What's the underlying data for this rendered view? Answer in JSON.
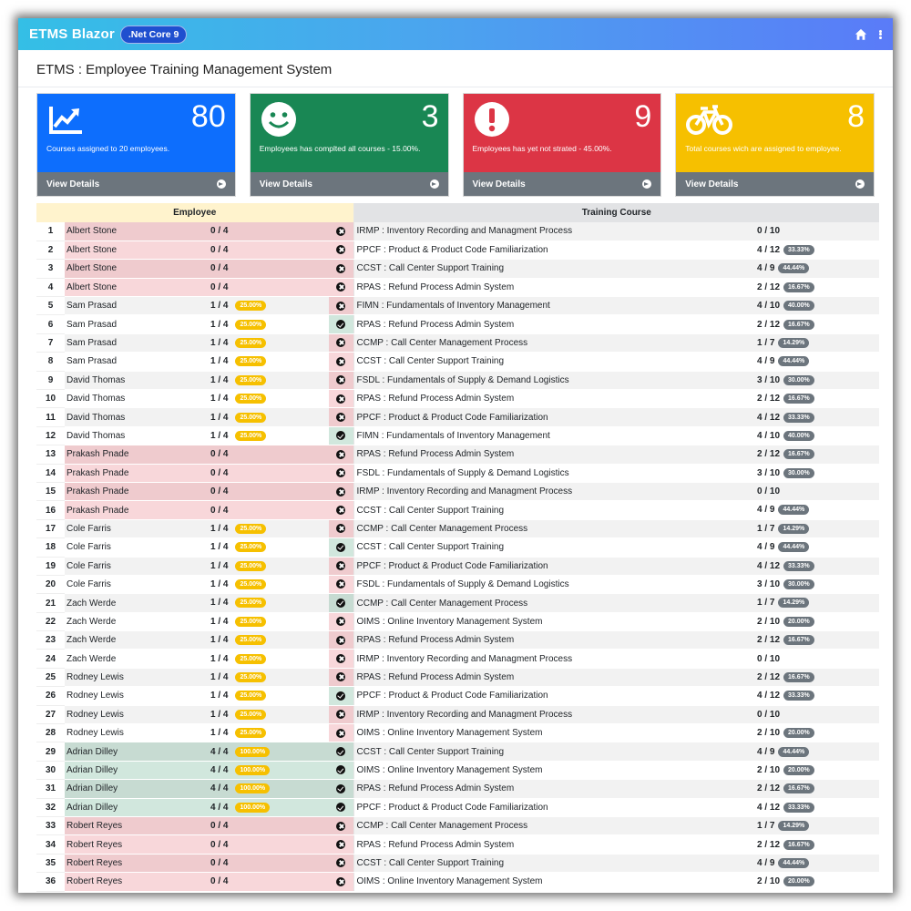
{
  "app": {
    "brand": "ETMS Blazor",
    "version_badge": ".Net Core 9",
    "home_icon": "home-icon",
    "menu_icon": "kebab-menu-icon"
  },
  "page": {
    "title": "ETMS : Employee Training Management System"
  },
  "cards": [
    {
      "icon": "chart-line-icon",
      "number": "80",
      "text": "Courses assigned to 20 employees.",
      "footer": "View Details",
      "color": "#0d6efd"
    },
    {
      "icon": "smile-icon",
      "number": "3",
      "text": "Employees has complted all courses - 15.00%.",
      "footer": "View Details",
      "color": "#198754"
    },
    {
      "icon": "exclamation-circle-icon",
      "number": "9",
      "text": "Employees has yet not strated - 45.00%.",
      "footer": "View Details",
      "color": "#dc3545"
    },
    {
      "icon": "bicycle-icon",
      "number": "8",
      "text": "Total courses wich are assigned to employee.",
      "footer": "View Details",
      "color": "#f6c000"
    }
  ],
  "table": {
    "headers": {
      "employee": "Employee",
      "course": "Training Course"
    },
    "rows": [
      {
        "n": "1",
        "name": "Albert Stone",
        "prog": "0 / 4",
        "pct": "",
        "done": false,
        "course": "IRMP : Inventory Recording and Managment Process",
        "cprog": "0 / 10",
        "cpct": ""
      },
      {
        "n": "2",
        "name": "Albert Stone",
        "prog": "0 / 4",
        "pct": "",
        "done": false,
        "course": "PPCF : Product & Product Code Familiarization",
        "cprog": "4 / 12",
        "cpct": "33.33%"
      },
      {
        "n": "3",
        "name": "Albert Stone",
        "prog": "0 / 4",
        "pct": "",
        "done": false,
        "course": "CCST : Call Center Support Training",
        "cprog": "4 / 9",
        "cpct": "44.44%"
      },
      {
        "n": "4",
        "name": "Albert Stone",
        "prog": "0 / 4",
        "pct": "",
        "done": false,
        "course": "RPAS : Refund Process Admin System",
        "cprog": "2 / 12",
        "cpct": "16.67%"
      },
      {
        "n": "5",
        "name": "Sam Prasad",
        "prog": "1 / 4",
        "pct": "25.00%",
        "done": false,
        "course": "FIMN : Fundamentals of Inventory Management",
        "cprog": "4 / 10",
        "cpct": "40.00%"
      },
      {
        "n": "6",
        "name": "Sam Prasad",
        "prog": "1 / 4",
        "pct": "25.00%",
        "done": true,
        "course": "RPAS : Refund Process Admin System",
        "cprog": "2 / 12",
        "cpct": "16.67%"
      },
      {
        "n": "7",
        "name": "Sam Prasad",
        "prog": "1 / 4",
        "pct": "25.00%",
        "done": false,
        "course": "CCMP : Call Center Management Process",
        "cprog": "1 / 7",
        "cpct": "14.29%"
      },
      {
        "n": "8",
        "name": "Sam Prasad",
        "prog": "1 / 4",
        "pct": "25.00%",
        "done": false,
        "course": "CCST : Call Center Support Training",
        "cprog": "4 / 9",
        "cpct": "44.44%"
      },
      {
        "n": "9",
        "name": "David Thomas",
        "prog": "1 / 4",
        "pct": "25.00%",
        "done": false,
        "course": "FSDL : Fundamentals of Supply & Demand Logistics",
        "cprog": "3 / 10",
        "cpct": "30.00%"
      },
      {
        "n": "10",
        "name": "David Thomas",
        "prog": "1 / 4",
        "pct": "25.00%",
        "done": false,
        "course": "RPAS : Refund Process Admin System",
        "cprog": "2 / 12",
        "cpct": "16.67%"
      },
      {
        "n": "11",
        "name": "David Thomas",
        "prog": "1 / 4",
        "pct": "25.00%",
        "done": false,
        "course": "PPCF : Product & Product Code Familiarization",
        "cprog": "4 / 12",
        "cpct": "33.33%"
      },
      {
        "n": "12",
        "name": "David Thomas",
        "prog": "1 / 4",
        "pct": "25.00%",
        "done": true,
        "course": "FIMN : Fundamentals of Inventory Management",
        "cprog": "4 / 10",
        "cpct": "40.00%"
      },
      {
        "n": "13",
        "name": "Prakash Pnade",
        "prog": "0 / 4",
        "pct": "",
        "done": false,
        "course": "RPAS : Refund Process Admin System",
        "cprog": "2 / 12",
        "cpct": "16.67%"
      },
      {
        "n": "14",
        "name": "Prakash Pnade",
        "prog": "0 / 4",
        "pct": "",
        "done": false,
        "course": "FSDL : Fundamentals of Supply & Demand Logistics",
        "cprog": "3 / 10",
        "cpct": "30.00%"
      },
      {
        "n": "15",
        "name": "Prakash Pnade",
        "prog": "0 / 4",
        "pct": "",
        "done": false,
        "course": "IRMP : Inventory Recording and Managment Process",
        "cprog": "0 / 10",
        "cpct": ""
      },
      {
        "n": "16",
        "name": "Prakash Pnade",
        "prog": "0 / 4",
        "pct": "",
        "done": false,
        "course": "CCST : Call Center Support Training",
        "cprog": "4 / 9",
        "cpct": "44.44%"
      },
      {
        "n": "17",
        "name": "Cole Farris",
        "prog": "1 / 4",
        "pct": "25.00%",
        "done": false,
        "course": "CCMP : Call Center Management Process",
        "cprog": "1 / 7",
        "cpct": "14.29%"
      },
      {
        "n": "18",
        "name": "Cole Farris",
        "prog": "1 / 4",
        "pct": "25.00%",
        "done": true,
        "course": "CCST : Call Center Support Training",
        "cprog": "4 / 9",
        "cpct": "44.44%"
      },
      {
        "n": "19",
        "name": "Cole Farris",
        "prog": "1 / 4",
        "pct": "25.00%",
        "done": false,
        "course": "PPCF : Product & Product Code Familiarization",
        "cprog": "4 / 12",
        "cpct": "33.33%"
      },
      {
        "n": "20",
        "name": "Cole Farris",
        "prog": "1 / 4",
        "pct": "25.00%",
        "done": false,
        "course": "FSDL : Fundamentals of Supply & Demand Logistics",
        "cprog": "3 / 10",
        "cpct": "30.00%"
      },
      {
        "n": "21",
        "name": "Zach Werde",
        "prog": "1 / 4",
        "pct": "25.00%",
        "done": true,
        "course": "CCMP : Call Center Management Process",
        "cprog": "1 / 7",
        "cpct": "14.29%"
      },
      {
        "n": "22",
        "name": "Zach Werde",
        "prog": "1 / 4",
        "pct": "25.00%",
        "done": false,
        "course": "OIMS : Online Inventory Management System",
        "cprog": "2 / 10",
        "cpct": "20.00%"
      },
      {
        "n": "23",
        "name": "Zach Werde",
        "prog": "1 / 4",
        "pct": "25.00%",
        "done": false,
        "course": "RPAS : Refund Process Admin System",
        "cprog": "2 / 12",
        "cpct": "16.67%"
      },
      {
        "n": "24",
        "name": "Zach Werde",
        "prog": "1 / 4",
        "pct": "25.00%",
        "done": false,
        "course": "IRMP : Inventory Recording and Managment Process",
        "cprog": "0 / 10",
        "cpct": ""
      },
      {
        "n": "25",
        "name": "Rodney Lewis",
        "prog": "1 / 4",
        "pct": "25.00%",
        "done": false,
        "course": "RPAS : Refund Process Admin System",
        "cprog": "2 / 12",
        "cpct": "16.67%"
      },
      {
        "n": "26",
        "name": "Rodney Lewis",
        "prog": "1 / 4",
        "pct": "25.00%",
        "done": true,
        "course": "PPCF : Product & Product Code Familiarization",
        "cprog": "4 / 12",
        "cpct": "33.33%"
      },
      {
        "n": "27",
        "name": "Rodney Lewis",
        "prog": "1 / 4",
        "pct": "25.00%",
        "done": false,
        "course": "IRMP : Inventory Recording and Managment Process",
        "cprog": "0 / 10",
        "cpct": ""
      },
      {
        "n": "28",
        "name": "Rodney Lewis",
        "prog": "1 / 4",
        "pct": "25.00%",
        "done": false,
        "course": "OIMS : Online Inventory Management System",
        "cprog": "2 / 10",
        "cpct": "20.00%"
      },
      {
        "n": "29",
        "name": "Adrian Dilley",
        "prog": "4 / 4",
        "pct": "100.00%",
        "done": true,
        "course": "CCST : Call Center Support Training",
        "cprog": "4 / 9",
        "cpct": "44.44%"
      },
      {
        "n": "30",
        "name": "Adrian Dilley",
        "prog": "4 / 4",
        "pct": "100.00%",
        "done": true,
        "course": "OIMS : Online Inventory Management System",
        "cprog": "2 / 10",
        "cpct": "20.00%"
      },
      {
        "n": "31",
        "name": "Adrian Dilley",
        "prog": "4 / 4",
        "pct": "100.00%",
        "done": true,
        "course": "RPAS : Refund Process Admin System",
        "cprog": "2 / 12",
        "cpct": "16.67%"
      },
      {
        "n": "32",
        "name": "Adrian Dilley",
        "prog": "4 / 4",
        "pct": "100.00%",
        "done": true,
        "course": "PPCF : Product & Product Code Familiarization",
        "cprog": "4 / 12",
        "cpct": "33.33%"
      },
      {
        "n": "33",
        "name": "Robert Reyes",
        "prog": "0 / 4",
        "pct": "",
        "done": false,
        "course": "CCMP : Call Center Management Process",
        "cprog": "1 / 7",
        "cpct": "14.29%"
      },
      {
        "n": "34",
        "name": "Robert Reyes",
        "prog": "0 / 4",
        "pct": "",
        "done": false,
        "course": "RPAS : Refund Process Admin System",
        "cprog": "2 / 12",
        "cpct": "16.67%"
      },
      {
        "n": "35",
        "name": "Robert Reyes",
        "prog": "0 / 4",
        "pct": "",
        "done": false,
        "course": "CCST : Call Center Support Training",
        "cprog": "4 / 9",
        "cpct": "44.44%"
      },
      {
        "n": "36",
        "name": "Robert Reyes",
        "prog": "0 / 4",
        "pct": "",
        "done": false,
        "course": "OIMS : Online Inventory Management System",
        "cprog": "2 / 10",
        "cpct": "20.00%"
      }
    ]
  }
}
